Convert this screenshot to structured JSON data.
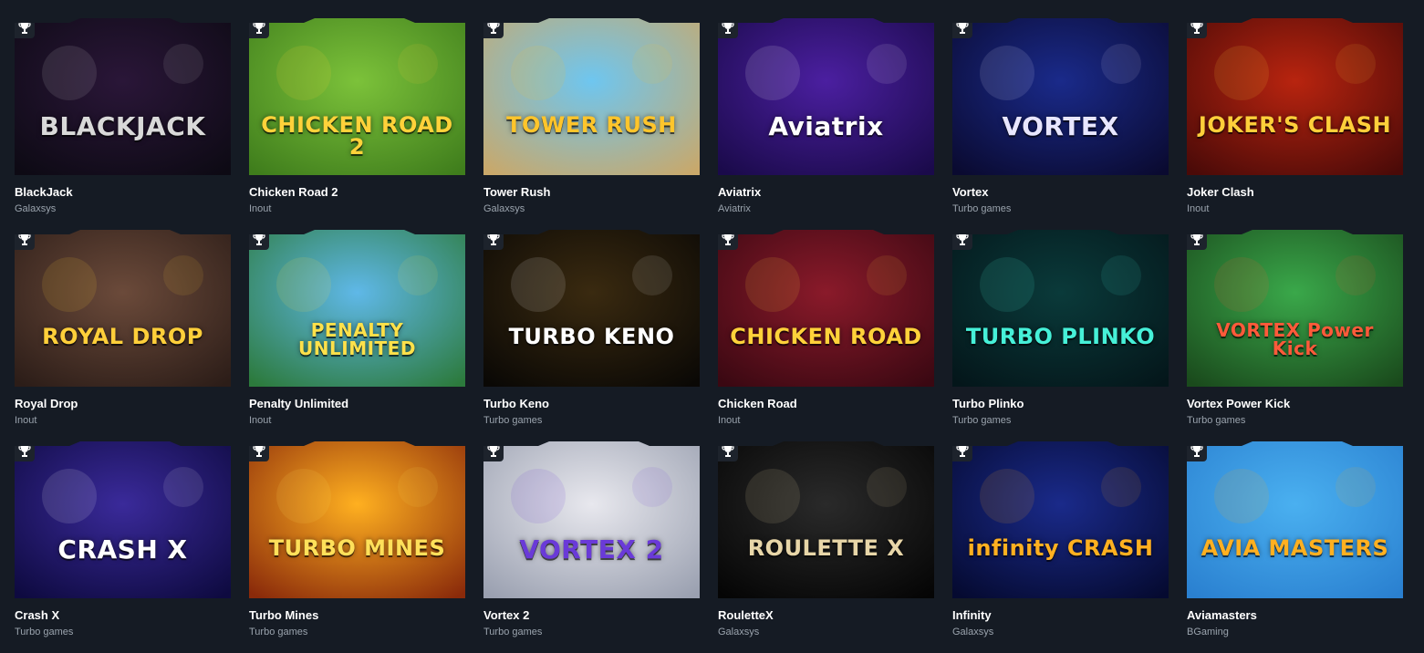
{
  "games": [
    {
      "name": "BlackJack",
      "provider": "Galaxsys",
      "art_text": "BLACKJACK",
      "colors": [
        "#2a1638",
        "#0d0a14"
      ],
      "accent": "#d9d9d9"
    },
    {
      "name": "Chicken Road 2",
      "provider": "Inout",
      "art_text": "CHICKEN ROAD 2",
      "colors": [
        "#7cc23a",
        "#3f7d1c"
      ],
      "accent": "#ffd23a"
    },
    {
      "name": "Tower Rush",
      "provider": "Galaxsys",
      "art_text": "TOWER RUSH",
      "colors": [
        "#6ec6f0",
        "#c9a86a"
      ],
      "accent": "#ffc52b"
    },
    {
      "name": "Aviatrix",
      "provider": "Aviatrix",
      "art_text": "Aviatrix",
      "colors": [
        "#4b1fa0",
        "#1a0a4a"
      ],
      "accent": "#ffffff"
    },
    {
      "name": "Vortex",
      "provider": "Turbo games",
      "art_text": "VORTEX",
      "colors": [
        "#1a2a8a",
        "#0a0a30"
      ],
      "accent": "#e8e6ff"
    },
    {
      "name": "Joker Clash",
      "provider": "Inout",
      "art_text": "JOKER'S CLASH",
      "colors": [
        "#b8240f",
        "#4a0a08"
      ],
      "accent": "#ffcf3a"
    },
    {
      "name": "Royal Drop",
      "provider": "Inout",
      "art_text": "ROYAL DROP",
      "colors": [
        "#6b4a3a",
        "#2c1d18"
      ],
      "accent": "#ffcf3a"
    },
    {
      "name": "Penalty Unlimited",
      "provider": "Inout",
      "art_text": "PENALTY UNLIMITED",
      "colors": [
        "#5fb8e8",
        "#2c7a3c"
      ],
      "accent": "#ffe14a"
    },
    {
      "name": "Turbo Keno",
      "provider": "Turbo games",
      "art_text": "TURBO KENO",
      "colors": [
        "#3a2a10",
        "#0a0805"
      ],
      "accent": "#ffffff"
    },
    {
      "name": "Chicken Road",
      "provider": "Inout",
      "art_text": "CHICKEN ROAD",
      "colors": [
        "#8a1a2a",
        "#3a0812"
      ],
      "accent": "#ffd23a"
    },
    {
      "name": "Turbo Plinko",
      "provider": "Turbo games",
      "art_text": "TURBO PLINKO",
      "colors": [
        "#0a3a3a",
        "#04161a"
      ],
      "accent": "#46f0d8"
    },
    {
      "name": "Vortex Power Kick",
      "provider": "Turbo games",
      "art_text": "VORTEX Power Kick",
      "colors": [
        "#3aa84a",
        "#1a4a1c"
      ],
      "accent": "#ff5a3a"
    },
    {
      "name": "Crash X",
      "provider": "Turbo games",
      "art_text": "CRASH X",
      "colors": [
        "#3a2a9a",
        "#0e0a40"
      ],
      "accent": "#ffffff"
    },
    {
      "name": "Turbo Mines",
      "provider": "Turbo games",
      "art_text": "TURBO MINES",
      "colors": [
        "#ffb020",
        "#8a2a0a"
      ],
      "accent": "#ffe05a"
    },
    {
      "name": "Vortex 2",
      "provider": "Turbo games",
      "art_text": "VORTEX 2",
      "colors": [
        "#e8e8ee",
        "#9aa0b0"
      ],
      "accent": "#6a3ad8"
    },
    {
      "name": "RouletteX",
      "provider": "Galaxsys",
      "art_text": "ROULETTE X",
      "colors": [
        "#2a2a2a",
        "#050505"
      ],
      "accent": "#e8d6a8"
    },
    {
      "name": "Infinity",
      "provider": "Galaxsys",
      "art_text": "infinity CRASH",
      "colors": [
        "#1a2a8a",
        "#050a30"
      ],
      "accent": "#ffb020"
    },
    {
      "name": "Aviamasters",
      "provider": "BGaming",
      "art_text": "AVIA MASTERS",
      "colors": [
        "#4ab0f0",
        "#2a80d0"
      ],
      "accent": "#ffb020"
    }
  ]
}
